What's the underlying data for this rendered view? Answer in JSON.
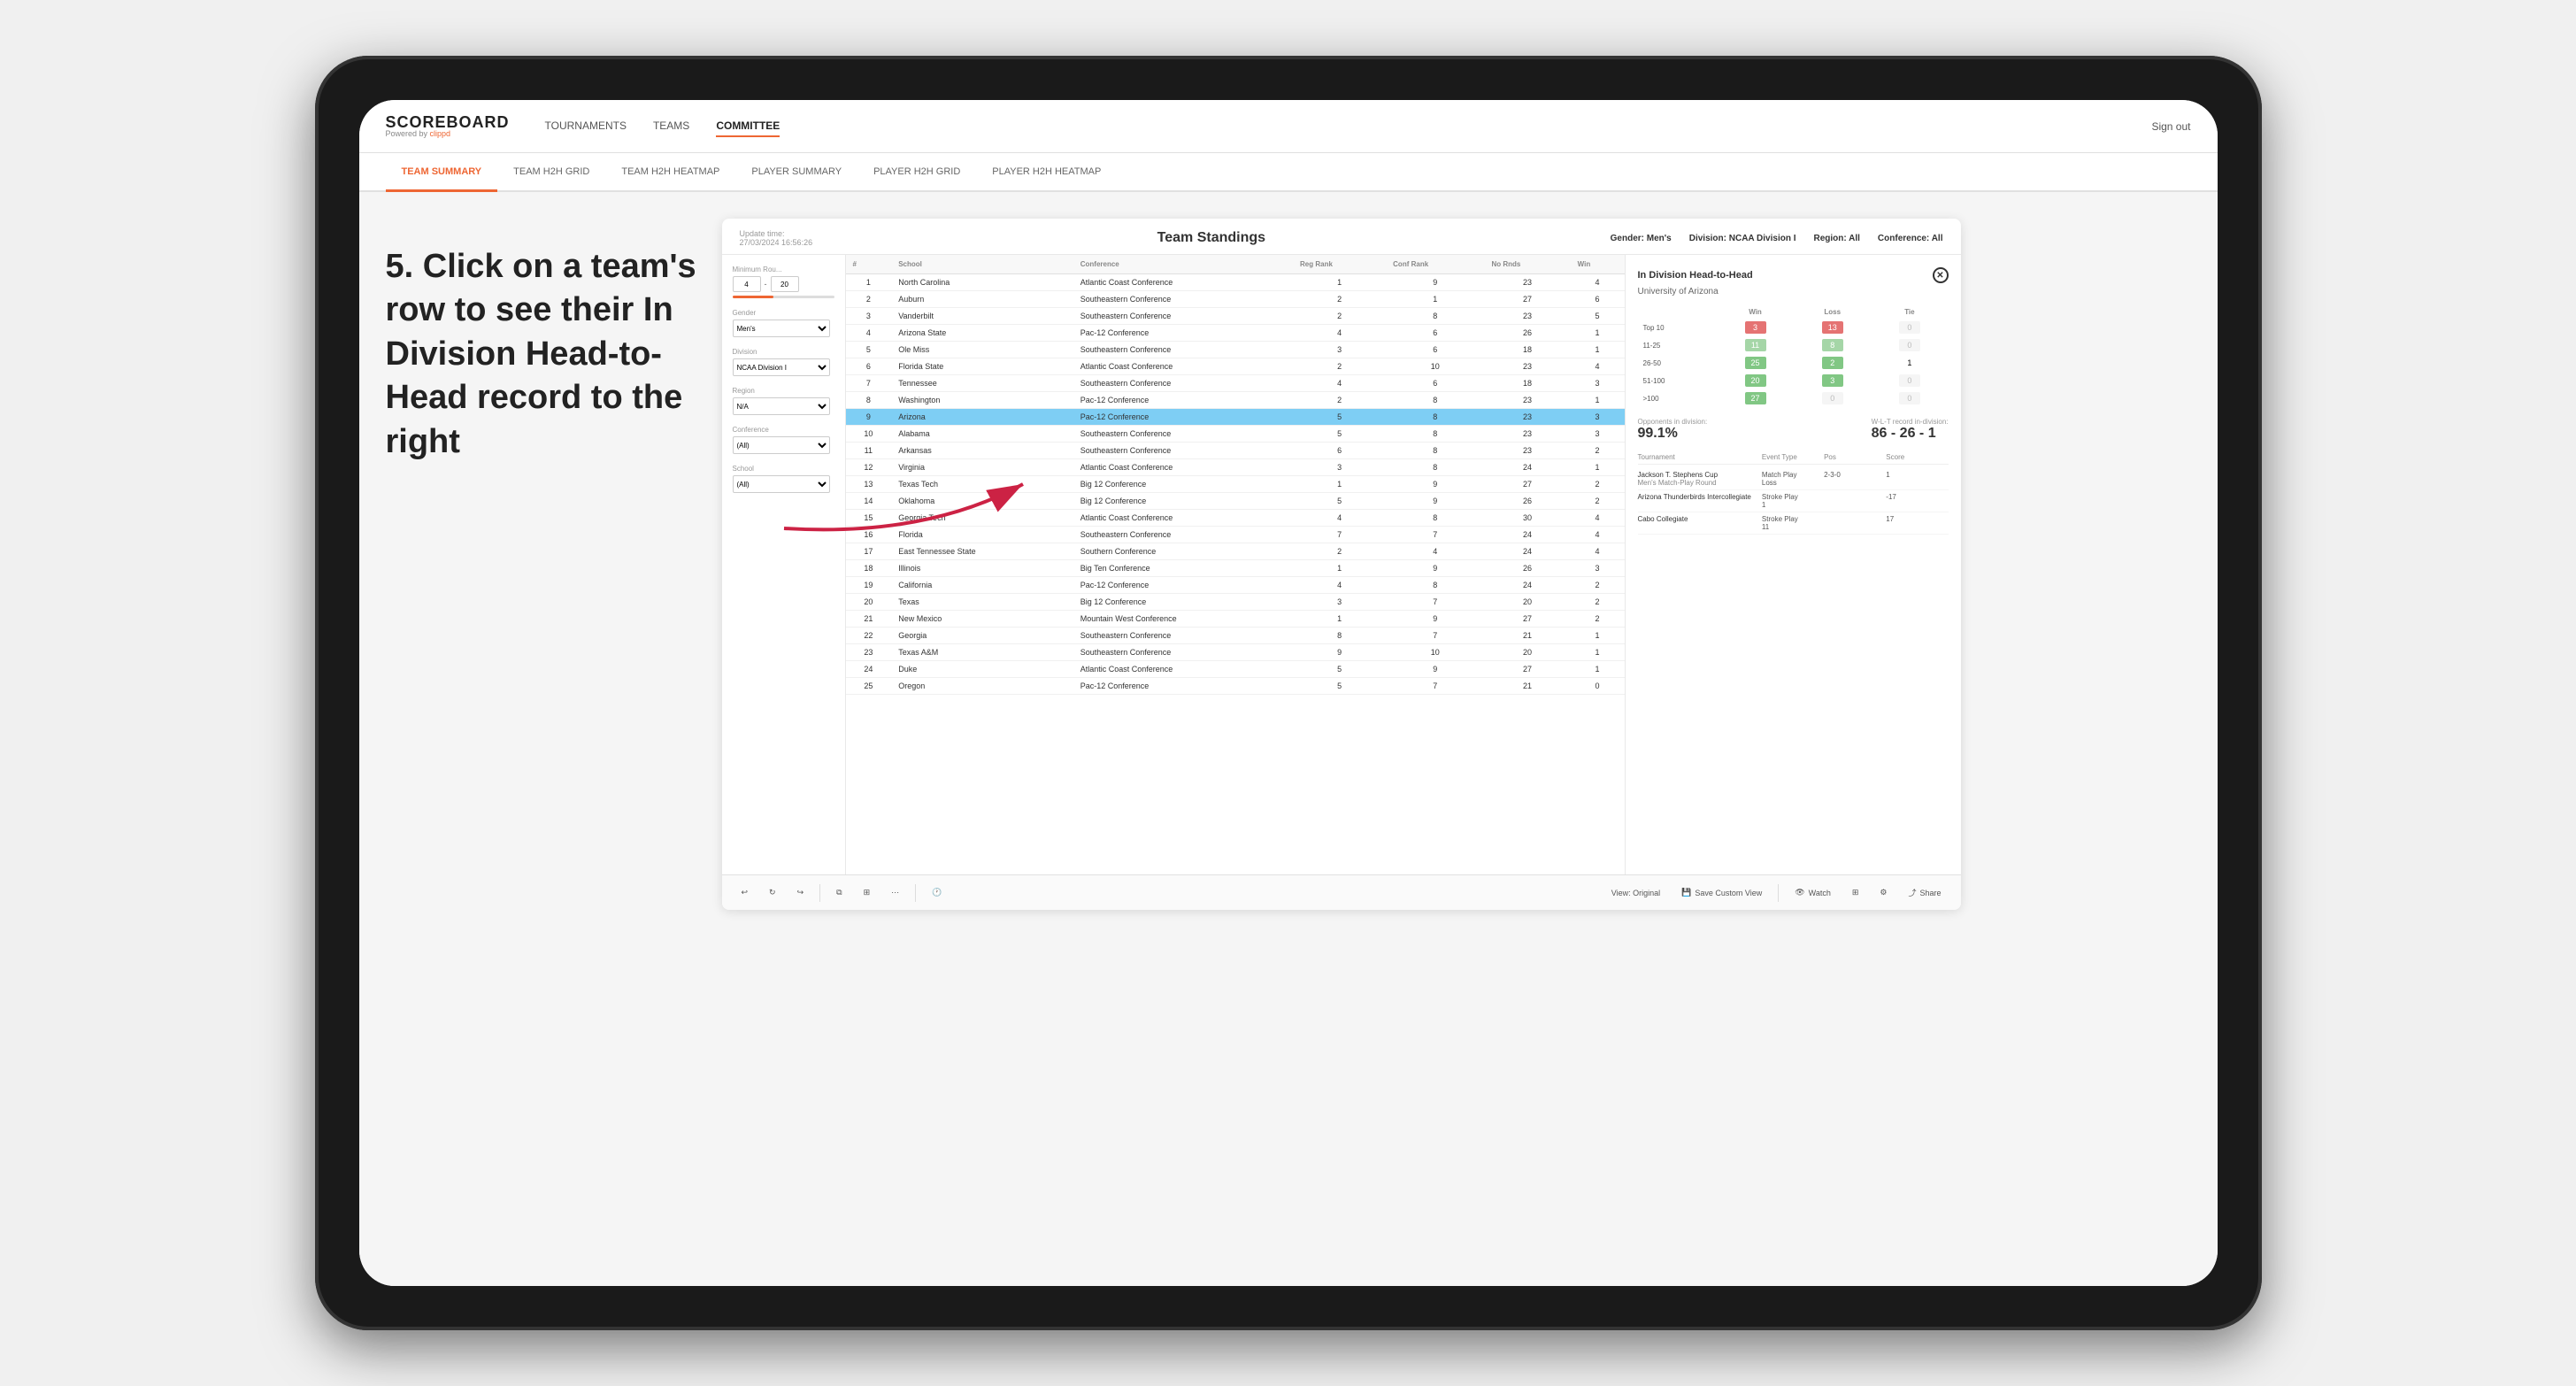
{
  "app": {
    "logo": "SCOREBOARD",
    "logo_sub": "Powered by",
    "logo_brand": "clippd",
    "sign_out": "Sign out"
  },
  "nav": {
    "items": [
      {
        "label": "TOURNAMENTS",
        "active": false
      },
      {
        "label": "TEAMS",
        "active": false
      },
      {
        "label": "COMMITTEE",
        "active": true
      }
    ]
  },
  "sub_nav": {
    "tabs": [
      {
        "label": "TEAM SUMMARY",
        "active": true
      },
      {
        "label": "TEAM H2H GRID",
        "active": false
      },
      {
        "label": "TEAM H2H HEATMAP",
        "active": false
      },
      {
        "label": "PLAYER SUMMARY",
        "active": false
      },
      {
        "label": "PLAYER H2H GRID",
        "active": false
      },
      {
        "label": "PLAYER H2H HEATMAP",
        "active": false
      }
    ]
  },
  "annotation": {
    "text": "5. Click on a team's row to see their In Division Head-to-Head record to the right"
  },
  "panel": {
    "update_label": "Update time:",
    "update_time": "27/03/2024 16:56:26",
    "title": "Team Standings",
    "gender_label": "Gender:",
    "gender_value": "Men's",
    "division_label": "Division:",
    "division_value": "NCAA Division I",
    "region_label": "Region:",
    "region_value": "All",
    "conference_label": "Conference:",
    "conference_value": "All"
  },
  "filters": {
    "min_rounds_label": "Minimum Rou...",
    "min_rounds_val": "4",
    "min_rounds_max": "20",
    "gender_label": "Gender",
    "gender_value": "Men's",
    "division_label": "Division",
    "division_value": "NCAA Division I",
    "region_label": "Region",
    "region_value": "N/A",
    "conference_label": "Conference",
    "conference_value": "(All)",
    "school_label": "School",
    "school_value": "(All)"
  },
  "table": {
    "columns": [
      "#",
      "School",
      "Conference",
      "Reg Rank",
      "Conf Rank",
      "No Rnds",
      "Win"
    ],
    "rows": [
      {
        "num": 1,
        "school": "North Carolina",
        "conference": "Atlantic Coast Conference",
        "reg_rank": 1,
        "conf_rank": 9,
        "rnds": 23,
        "win": 4
      },
      {
        "num": 2,
        "school": "Auburn",
        "conference": "Southeastern Conference",
        "reg_rank": 2,
        "conf_rank": 1,
        "rnds": 27,
        "win": 6
      },
      {
        "num": 3,
        "school": "Vanderbilt",
        "conference": "Southeastern Conference",
        "reg_rank": 2,
        "conf_rank": 8,
        "rnds": 23,
        "win": 5
      },
      {
        "num": 4,
        "school": "Arizona State",
        "conference": "Pac-12 Conference",
        "reg_rank": 4,
        "conf_rank": 6,
        "rnds": 26,
        "win": 1
      },
      {
        "num": 5,
        "school": "Ole Miss",
        "conference": "Southeastern Conference",
        "reg_rank": 3,
        "conf_rank": 6,
        "rnds": 18,
        "win": 1
      },
      {
        "num": 6,
        "school": "Florida State",
        "conference": "Atlantic Coast Conference",
        "reg_rank": 2,
        "conf_rank": 10,
        "rnds": 23,
        "win": 4
      },
      {
        "num": 7,
        "school": "Tennessee",
        "conference": "Southeastern Conference",
        "reg_rank": 4,
        "conf_rank": 6,
        "rnds": 18,
        "win": 3
      },
      {
        "num": 8,
        "school": "Washington",
        "conference": "Pac-12 Conference",
        "reg_rank": 2,
        "conf_rank": 8,
        "rnds": 23,
        "win": 1
      },
      {
        "num": 9,
        "school": "Arizona",
        "conference": "Pac-12 Conference",
        "reg_rank": 5,
        "conf_rank": 8,
        "rnds": 23,
        "win": 3,
        "selected": true
      },
      {
        "num": 10,
        "school": "Alabama",
        "conference": "Southeastern Conference",
        "reg_rank": 5,
        "conf_rank": 8,
        "rnds": 23,
        "win": 3
      },
      {
        "num": 11,
        "school": "Arkansas",
        "conference": "Southeastern Conference",
        "reg_rank": 6,
        "conf_rank": 8,
        "rnds": 23,
        "win": 2
      },
      {
        "num": 12,
        "school": "Virginia",
        "conference": "Atlantic Coast Conference",
        "reg_rank": 3,
        "conf_rank": 8,
        "rnds": 24,
        "win": 1
      },
      {
        "num": 13,
        "school": "Texas Tech",
        "conference": "Big 12 Conference",
        "reg_rank": 1,
        "conf_rank": 9,
        "rnds": 27,
        "win": 2
      },
      {
        "num": 14,
        "school": "Oklahoma",
        "conference": "Big 12 Conference",
        "reg_rank": 5,
        "conf_rank": 9,
        "rnds": 26,
        "win": 2
      },
      {
        "num": 15,
        "school": "Georgia Tech",
        "conference": "Atlantic Coast Conference",
        "reg_rank": 4,
        "conf_rank": 8,
        "rnds": 30,
        "win": 4
      },
      {
        "num": 16,
        "school": "Florida",
        "conference": "Southeastern Conference",
        "reg_rank": 7,
        "conf_rank": 7,
        "rnds": 24,
        "win": 4
      },
      {
        "num": 17,
        "school": "East Tennessee State",
        "conference": "Southern Conference",
        "reg_rank": 2,
        "conf_rank": 4,
        "rnds": 24,
        "win": 4
      },
      {
        "num": 18,
        "school": "Illinois",
        "conference": "Big Ten Conference",
        "reg_rank": 1,
        "conf_rank": 9,
        "rnds": 26,
        "win": 3
      },
      {
        "num": 19,
        "school": "California",
        "conference": "Pac-12 Conference",
        "reg_rank": 4,
        "conf_rank": 8,
        "rnds": 24,
        "win": 2
      },
      {
        "num": 20,
        "school": "Texas",
        "conference": "Big 12 Conference",
        "reg_rank": 3,
        "conf_rank": 7,
        "rnds": 20,
        "win": 2
      },
      {
        "num": 21,
        "school": "New Mexico",
        "conference": "Mountain West Conference",
        "reg_rank": 1,
        "conf_rank": 9,
        "rnds": 27,
        "win": 2
      },
      {
        "num": 22,
        "school": "Georgia",
        "conference": "Southeastern Conference",
        "reg_rank": 8,
        "conf_rank": 7,
        "rnds": 21,
        "win": 1
      },
      {
        "num": 23,
        "school": "Texas A&M",
        "conference": "Southeastern Conference",
        "reg_rank": 9,
        "conf_rank": 10,
        "rnds": 20,
        "win": 1
      },
      {
        "num": 24,
        "school": "Duke",
        "conference": "Atlantic Coast Conference",
        "reg_rank": 5,
        "conf_rank": 9,
        "rnds": 27,
        "win": 1
      },
      {
        "num": 25,
        "school": "Oregon",
        "conference": "Pac-12 Conference",
        "reg_rank": 5,
        "conf_rank": 7,
        "rnds": 21,
        "win": 0
      }
    ]
  },
  "h2h": {
    "title": "In Division Head-to-Head",
    "team_name": "University of Arizona",
    "win_label": "Win",
    "loss_label": "Loss",
    "tie_label": "Tie",
    "rows": [
      {
        "rank": "Top 10",
        "win": 3,
        "loss": 13,
        "tie": 0,
        "win_color": "red",
        "loss_color": "red"
      },
      {
        "rank": "11-25",
        "win": 11,
        "loss": 8,
        "tie": 0,
        "win_color": "light-green",
        "loss_color": "light-green"
      },
      {
        "rank": "26-50",
        "win": 25,
        "loss": 2,
        "tie": 1,
        "win_color": "green",
        "loss_color": "green"
      },
      {
        "rank": "51-100",
        "win": 20,
        "loss": 3,
        "tie": 0,
        "win_color": "green",
        "loss_color": "green"
      },
      {
        "rank": ">100",
        "win": 27,
        "loss": 0,
        "tie": 0,
        "win_color": "green",
        "loss_color": "zero"
      }
    ],
    "opponents_label": "Opponents in division:",
    "opponents_value": "99.1%",
    "wlt_label": "W-L-T record in-division:",
    "wlt_value": "86 - 26 - 1",
    "tournament_label": "Tournament",
    "event_type_label": "Event Type",
    "pos_label": "Pos",
    "score_label": "Score",
    "tournaments": [
      {
        "name": "Jackson T. Stephens Cup",
        "sub": "Men's Match-Play Round",
        "event_type": "Match Play",
        "result": "Loss",
        "pos": "2-3-0",
        "score": "1"
      },
      {
        "name": "Arizona Thunderbirds Intercollegiate",
        "sub": "",
        "event_type": "Stroke Play",
        "result": "1",
        "pos": "",
        "score": "-17"
      },
      {
        "name": "Cabo Collegiate",
        "sub": "",
        "event_type": "Stroke Play",
        "result": "11",
        "pos": "",
        "score": "17"
      }
    ]
  },
  "toolbar": {
    "view_original": "View: Original",
    "save_custom": "Save Custom View",
    "watch": "Watch",
    "share": "Share"
  }
}
